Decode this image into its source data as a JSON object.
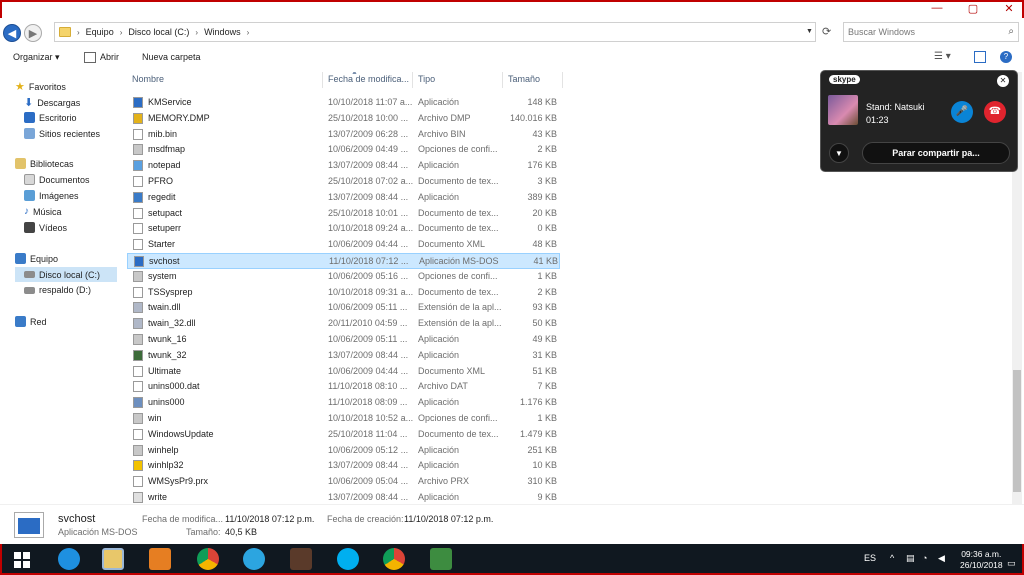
{
  "address": {
    "crumbs": [
      "Equipo",
      "Disco local (C:)",
      "Windows"
    ],
    "search_placeholder": "Buscar Windows"
  },
  "toolbar": {
    "organize": "Organizar ▾",
    "open": "Abrir",
    "new_folder": "Nueva carpeta"
  },
  "nav": {
    "favorites": "Favoritos",
    "downloads": "Descargas",
    "desktop": "Escritorio",
    "recent": "Sitios recientes",
    "libraries": "Bibliotecas",
    "documents": "Documentos",
    "images": "Imágenes",
    "music": "Música",
    "videos": "Vídeos",
    "computer": "Equipo",
    "local_disk": "Disco local (C:)",
    "backup": "respaldo (D:)",
    "network": "Red"
  },
  "columns": {
    "name": "Nombre",
    "date": "Fecha de modifica...",
    "type": "Tipo",
    "size": "Tamaño"
  },
  "files": [
    {
      "name": "KMService",
      "date": "10/10/2018 11:07 a...",
      "type": "Aplicación",
      "size": "148 KB",
      "icon": "app"
    },
    {
      "name": "MEMORY.DMP",
      "date": "25/10/2018 10:00 ...",
      "type": "Archivo DMP",
      "size": "140.016 KB",
      "icon": "lock"
    },
    {
      "name": "mib.bin",
      "date": "13/07/2009 06:28 ...",
      "type": "Archivo BIN",
      "size": "43 KB",
      "icon": "doc"
    },
    {
      "name": "msdfmap",
      "date": "10/06/2009 04:49 ...",
      "type": "Opciones de confi...",
      "size": "2 KB",
      "icon": "cfg"
    },
    {
      "name": "notepad",
      "date": "13/07/2009 08:44 ...",
      "type": "Aplicación",
      "size": "176 KB",
      "icon": "notepad"
    },
    {
      "name": "PFRO",
      "date": "25/10/2018 07:02 a...",
      "type": "Documento de tex...",
      "size": "3 KB",
      "icon": "doc"
    },
    {
      "name": "regedit",
      "date": "13/07/2009 08:44 ...",
      "type": "Aplicación",
      "size": "389 KB",
      "icon": "regedit"
    },
    {
      "name": "setupact",
      "date": "25/10/2018 10:01 ...",
      "type": "Documento de tex...",
      "size": "20 KB",
      "icon": "doc"
    },
    {
      "name": "setuperr",
      "date": "10/10/2018 09:24 a...",
      "type": "Documento de tex...",
      "size": "0 KB",
      "icon": "doc"
    },
    {
      "name": "Starter",
      "date": "10/06/2009 04:44 ...",
      "type": "Documento XML",
      "size": "48 KB",
      "icon": "doc"
    },
    {
      "name": "svchost",
      "date": "11/10/2018 07:12 ...",
      "type": "Aplicación MS-DOS",
      "size": "41 KB",
      "icon": "app",
      "selected": true
    },
    {
      "name": "system",
      "date": "10/06/2009 05:16 ...",
      "type": "Opciones de confi...",
      "size": "1 KB",
      "icon": "cfg"
    },
    {
      "name": "TSSysprep",
      "date": "10/10/2018 09:31 a...",
      "type": "Documento de tex...",
      "size": "2 KB",
      "icon": "doc"
    },
    {
      "name": "twain.dll",
      "date": "10/06/2009 05:11 ...",
      "type": "Extensión de la apl...",
      "size": "93 KB",
      "icon": "dll"
    },
    {
      "name": "twain_32.dll",
      "date": "20/11/2010 04:59 ...",
      "type": "Extensión de la apl...",
      "size": "50 KB",
      "icon": "dll"
    },
    {
      "name": "twunk_16",
      "date": "10/06/2009 05:11 ...",
      "type": "Aplicación",
      "size": "49 KB",
      "icon": "cfg"
    },
    {
      "name": "twunk_32",
      "date": "13/07/2009 08:44 ...",
      "type": "Aplicación",
      "size": "31 KB",
      "icon": "twunk"
    },
    {
      "name": "Ultimate",
      "date": "10/06/2009 04:44 ...",
      "type": "Documento XML",
      "size": "51 KB",
      "icon": "doc"
    },
    {
      "name": "unins000.dat",
      "date": "11/10/2018 08:10 ...",
      "type": "Archivo DAT",
      "size": "7 KB",
      "icon": "doc"
    },
    {
      "name": "unins000",
      "date": "11/10/2018 08:09 ...",
      "type": "Aplicación",
      "size": "1.176 KB",
      "icon": "unins"
    },
    {
      "name": "win",
      "date": "10/10/2018 10:52 a...",
      "type": "Opciones de confi...",
      "size": "1 KB",
      "icon": "cfg"
    },
    {
      "name": "WindowsUpdate",
      "date": "25/10/2018 11:04 ...",
      "type": "Documento de tex...",
      "size": "1.479 KB",
      "icon": "doc"
    },
    {
      "name": "winhelp",
      "date": "10/06/2009 05:12 ...",
      "type": "Aplicación",
      "size": "251 KB",
      "icon": "cfg"
    },
    {
      "name": "winhlp32",
      "date": "13/07/2009 08:44 ...",
      "type": "Aplicación",
      "size": "10 KB",
      "icon": "help"
    },
    {
      "name": "WMSysPr9.prx",
      "date": "10/06/2009 05:04 ...",
      "type": "Archivo PRX",
      "size": "310 KB",
      "icon": "doc"
    },
    {
      "name": "write",
      "date": "13/07/2009 08:44 ...",
      "type": "Aplicación",
      "size": "9 KB",
      "icon": "write"
    }
  ],
  "details": {
    "name": "svchost",
    "type": "Aplicación MS-DOS",
    "modified_label": "Fecha de modifica...",
    "modified_value": "11/10/2018 07:12 p.m.",
    "created_label": "Fecha de creación:",
    "created_value": "11/10/2018 07:12 p.m.",
    "size_label": "Tamaño:",
    "size_value": "40,5 KB"
  },
  "skype": {
    "logo": "skype",
    "status": "Stand: Natsuki",
    "duration": "01:23",
    "share_label": "Parar compartir pa..."
  },
  "taskbar": {
    "lang": "ES",
    "time": "09:36 a.m.",
    "date": "26/10/2018"
  }
}
